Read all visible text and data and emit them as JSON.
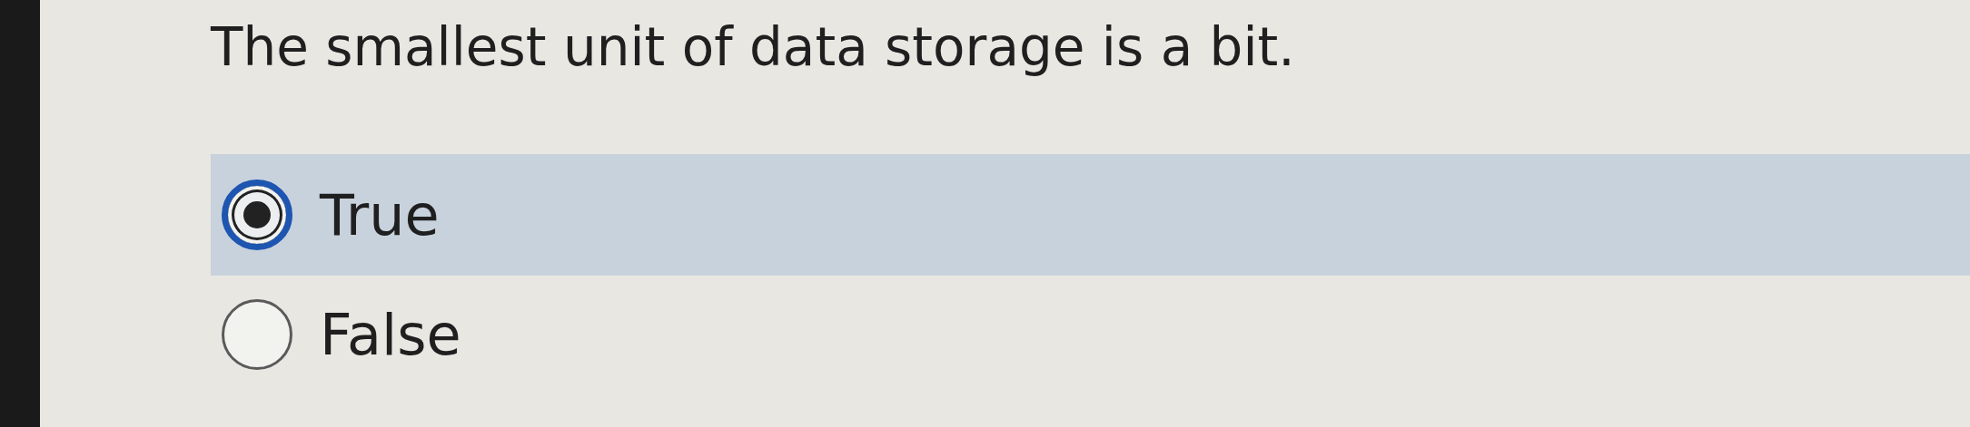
{
  "question": {
    "text": "The smallest unit of data storage is a bit."
  },
  "options": [
    {
      "label": "True",
      "selected": true
    },
    {
      "label": "False",
      "selected": false
    }
  ]
}
